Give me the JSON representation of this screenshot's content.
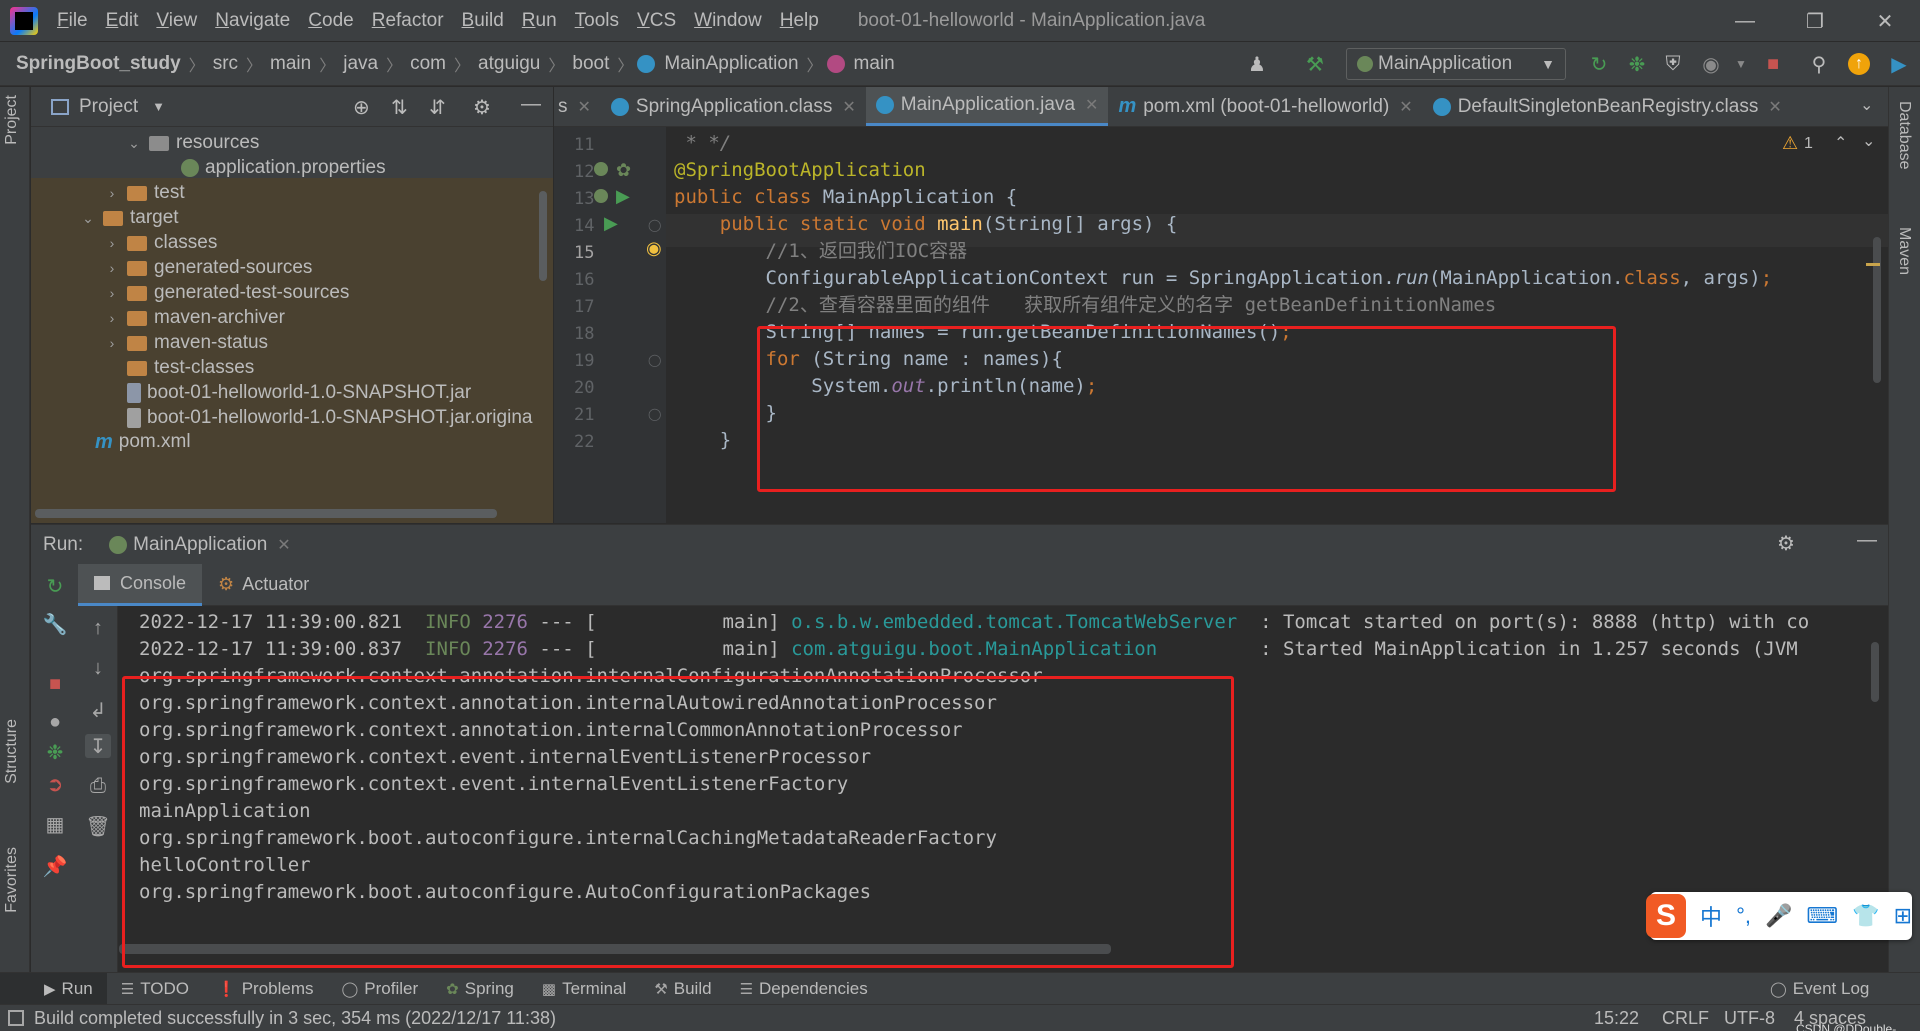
{
  "menubar": {
    "items": [
      "File",
      "Edit",
      "View",
      "Navigate",
      "Code",
      "Refactor",
      "Build",
      "Run",
      "Tools",
      "VCS",
      "Window",
      "Help"
    ],
    "title": "boot-01-helloworld - MainApplication.java",
    "minimize": "—",
    "restore": "❐",
    "close": "✕"
  },
  "breadcrumb": {
    "items": [
      "SpringBoot_study",
      "src",
      "main",
      "java",
      "com",
      "atguigu",
      "boot",
      "MainApplication",
      "main"
    ],
    "sep": "〉"
  },
  "toolbar": {
    "run_config": "MainApplication",
    "dropdown": "▼"
  },
  "left_strip": {
    "project": "Project",
    "structure": "Structure",
    "favorites": "Favorites"
  },
  "right_strip": {
    "database": "Database",
    "maven": "Maven"
  },
  "project_panel": {
    "title": "Project",
    "dropdown": "▼",
    "tree": [
      {
        "label": "resources",
        "arrow": "⌄"
      },
      {
        "label": "application.properties",
        "arrow": ""
      },
      {
        "label": "test",
        "arrow": "›"
      },
      {
        "label": "target",
        "arrow": "⌄"
      },
      {
        "label": "classes",
        "arrow": "›"
      },
      {
        "label": "generated-sources",
        "arrow": "›"
      },
      {
        "label": "generated-test-sources",
        "arrow": "›"
      },
      {
        "label": "maven-archiver",
        "arrow": "›"
      },
      {
        "label": "maven-status",
        "arrow": "›"
      },
      {
        "label": "test-classes",
        "arrow": ""
      },
      {
        "label": "boot-01-helloworld-1.0-SNAPSHOT.jar",
        "arrow": ""
      },
      {
        "label": "boot-01-helloworld-1.0-SNAPSHOT.jar.origina",
        "arrow": ""
      },
      {
        "label": "pom.xml",
        "arrow": ""
      }
    ]
  },
  "editor_tabs": [
    {
      "label": "s",
      "close": "✕"
    },
    {
      "label": "SpringApplication.class",
      "close": "✕"
    },
    {
      "label": "MainApplication.java",
      "close": "✕"
    },
    {
      "label": "pom.xml (boot-01-helloworld)",
      "close": "✕"
    },
    {
      "label": "DefaultSingletonBeanRegistry.class",
      "close": "✕"
    }
  ],
  "editor": {
    "line_numbers": [
      "11",
      "12",
      "13",
      "14",
      "15",
      "16",
      "17",
      "18",
      "19",
      "20",
      "21",
      "22"
    ],
    "warning_count": "1",
    "lines": {
      "l11": " * */",
      "l12": "@SpringBootApplication",
      "l13a": "public class ",
      "l13b": "MainApplication {",
      "l14a": "    public static void ",
      "l14b": "main",
      "l14c": "(String[] args) {",
      "l15": "        //1、返回我们IOC容器",
      "l16a": "        ConfigurableApplicationContext run = SpringApplication.",
      "l16b": "run",
      "l16c": "(MainApplication.",
      "l16d": "class",
      "l16e": ", args)",
      "l16f": ";",
      "l17": "        //2、查看容器里面的组件   获取所有组件定义的名字 getBeanDefinitionNames",
      "l18a": "        String[] names = run.getBeanDefinitionNames()",
      "l18b": ";",
      "l19a": "        for ",
      "l19b": "(String name : names){",
      "l20a": "            System.",
      "l20b": "out",
      "l20c": ".println(name)",
      "l20d": ";",
      "l21": "        }",
      "l22": "    }"
    }
  },
  "run_panel": {
    "label": "Run:",
    "config_tab": "MainApplication",
    "close": "✕",
    "subtabs": [
      "Console",
      "Actuator"
    ]
  },
  "console": {
    "log": [
      {
        "time": "2022-12-17 11:39:00.821",
        "level": "INFO",
        "pid": "2276",
        "thread": " --- [           main] ",
        "logger": "o.s.b.w.embedded.tomcat.TomcatWebServer",
        "msg": "  : Tomcat started on port(s): 8888 (http) with co"
      },
      {
        "time": "2022-12-17 11:39:00.837",
        "level": "INFO",
        "pid": "2276",
        "thread": " --- [           main] ",
        "logger": "com.atguigu.boot.MainApplication",
        "msg": "         : Started MainApplication in 1.257 seconds (JVM"
      }
    ],
    "beans": [
      "org.springframework.context.annotation.internalConfigurationAnnotationProcessor",
      "org.springframework.context.annotation.internalAutowiredAnnotationProcessor",
      "org.springframework.context.annotation.internalCommonAnnotationProcessor",
      "org.springframework.context.event.internalEventListenerProcessor",
      "org.springframework.context.event.internalEventListenerFactory",
      "mainApplication",
      "org.springframework.boot.autoconfigure.internalCachingMetadataReaderFactory",
      "helloController",
      "org.springframework.boot.autoconfigure.AutoConfigurationPackages"
    ]
  },
  "bottom_tabs": [
    "Run",
    "TODO",
    "Problems",
    "Profiler",
    "Spring",
    "Terminal",
    "Build",
    "Dependencies"
  ],
  "event_log": "Event Log",
  "status": {
    "message": "Build completed successfully in 3 sec, 354 ms (2022/12/17 11:38)",
    "position": "15:22",
    "line_sep": "CRLF",
    "encoding": "UTF-8",
    "indent": "4 spaces",
    "watermark": "CSDN @DDouble-"
  },
  "ime": {
    "logo": "S",
    "items": [
      "中",
      "°,",
      "🎤",
      "⌨",
      "👕",
      "⊞"
    ]
  },
  "colors": {
    "accent": "#4a88c7",
    "highlight_box": "#e8201f",
    "keyword": "#cc7832",
    "annotation": "#bbb529"
  }
}
